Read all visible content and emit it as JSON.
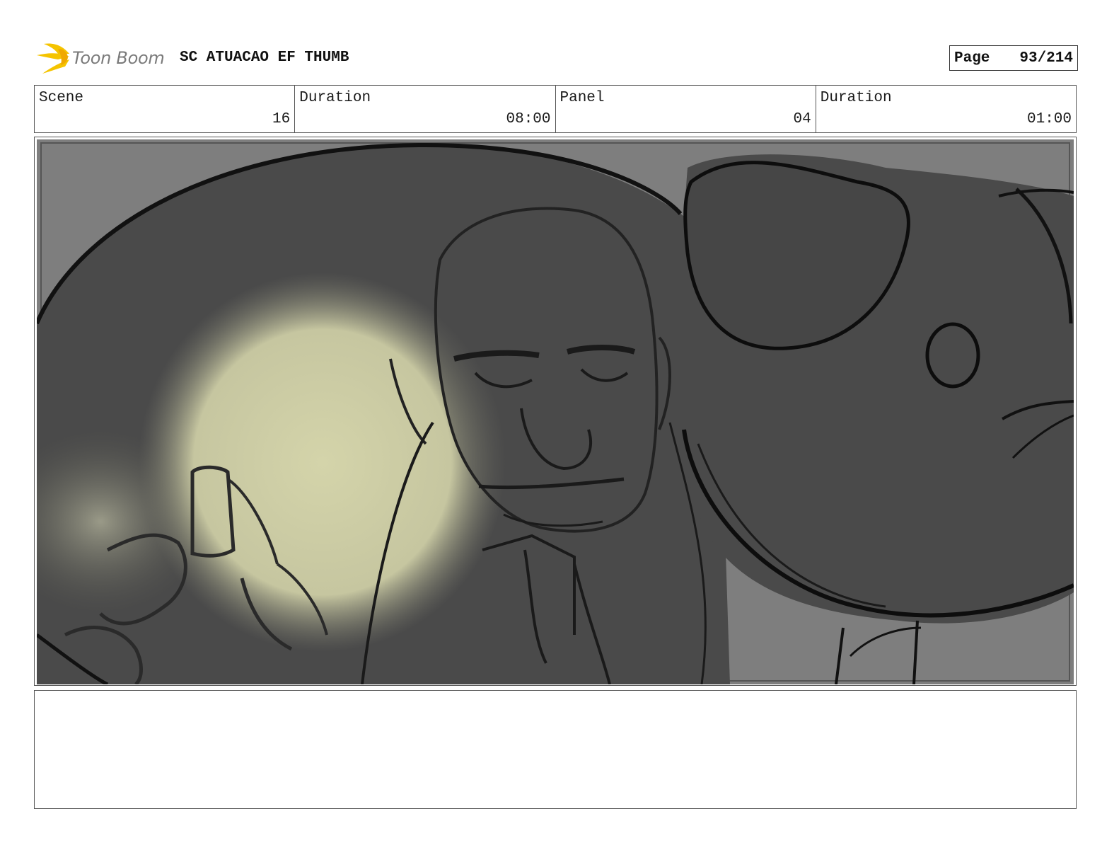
{
  "header": {
    "logo_text": "Toon Boom",
    "logo_icon": "toon-boom-flame-logo",
    "title": "SC ATUACAO EF THUMB",
    "page_label": "Page",
    "page_value": "93/214"
  },
  "info": {
    "scene_label": "Scene",
    "scene_value": "16",
    "scene_duration_label": "Duration",
    "scene_duration_value": "08:00",
    "panel_label": "Panel",
    "panel_value": "04",
    "panel_duration_label": "Duration",
    "panel_duration_value": "01:00"
  },
  "panel": {
    "image_description_icon": "storyboard-sketch-image"
  },
  "caption": {
    "text": ""
  },
  "colors": {
    "logo_yellow": "#f5c400",
    "panel_bg": "#7e7e7e",
    "shape_dark": "#4a4a4a",
    "spotlight": "#d8d8b0"
  }
}
